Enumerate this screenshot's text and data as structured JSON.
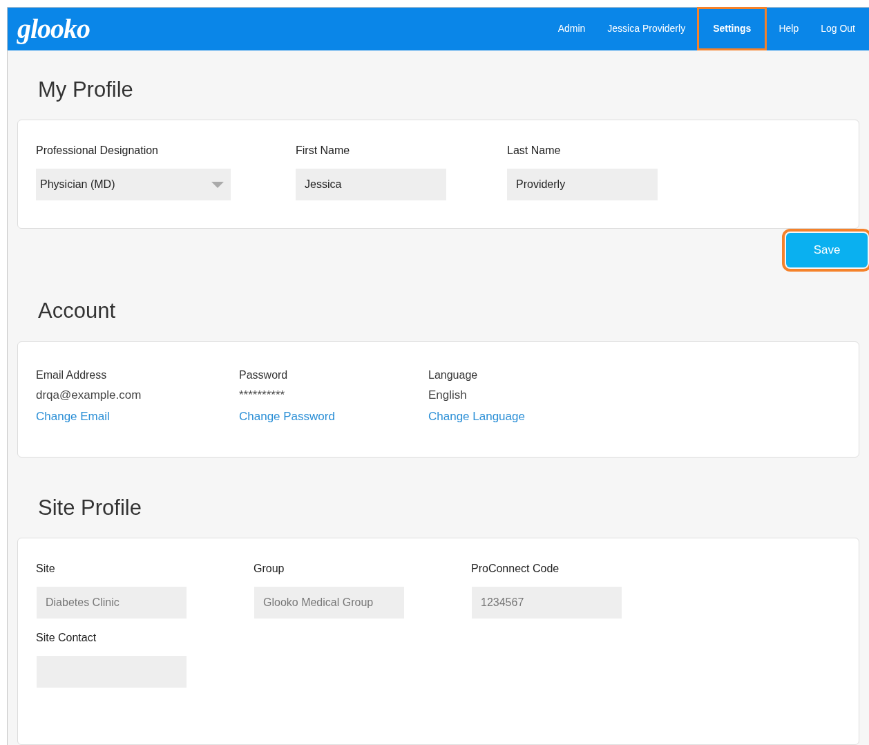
{
  "header": {
    "logo": "glooko",
    "nav": [
      {
        "label": "Admin",
        "selected": false,
        "highlighted": false
      },
      {
        "label": "Jessica Providerly",
        "selected": false,
        "highlighted": false
      },
      {
        "label": "Settings",
        "selected": true,
        "highlighted": true
      },
      {
        "label": "Help",
        "selected": false,
        "highlighted": false
      },
      {
        "label": "Log Out",
        "selected": false,
        "highlighted": false
      }
    ]
  },
  "my_profile": {
    "title": "My Profile",
    "fields": [
      {
        "kind": "select",
        "label": "Professional Designation",
        "value": "Physician (MD)"
      },
      {
        "kind": "input",
        "label": "First Name",
        "value": "Jessica"
      },
      {
        "kind": "input",
        "label": "Last Name",
        "value": "Providerly"
      }
    ],
    "save_button": {
      "label": "Save",
      "highlighted": true
    }
  },
  "account": {
    "title": "Account",
    "items": [
      {
        "label": "Email Address",
        "value": "drqa@example.com",
        "link": "Change Email"
      },
      {
        "label": "Password",
        "value": "**********",
        "link": "Change Password"
      },
      {
        "label": "Language",
        "value": "English",
        "link": "Change Language"
      }
    ]
  },
  "site_profile": {
    "title": "Site Profile",
    "fields": [
      {
        "label": "Site",
        "value": "Diabetes Clinic"
      },
      {
        "label": "Group",
        "value": "Glooko Medical Group"
      },
      {
        "label": "ProConnect Code",
        "value": "1234567"
      },
      {
        "label": "Site Contact"
      }
    ]
  }
}
